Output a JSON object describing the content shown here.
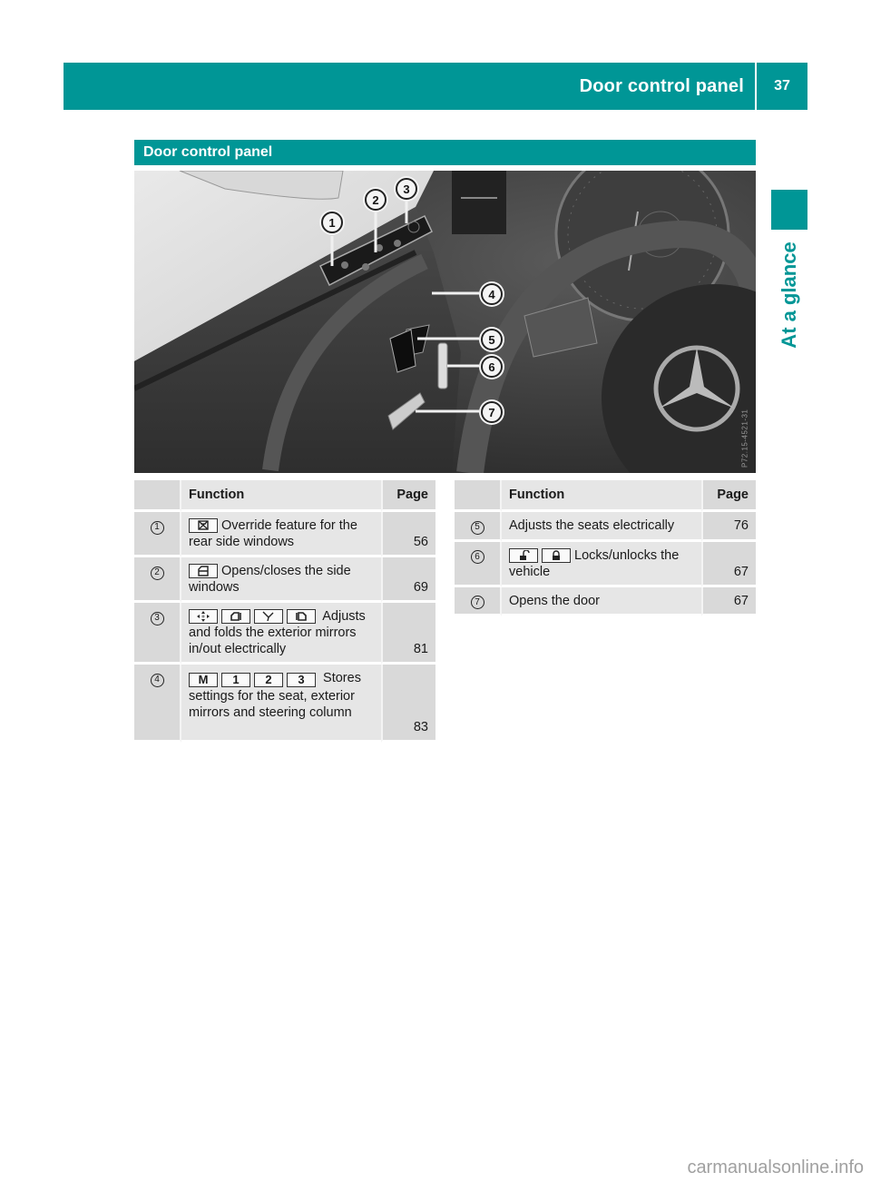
{
  "running_header": {
    "title": "Door control panel",
    "page_number": "37"
  },
  "side_tab": {
    "label": "At a glance"
  },
  "section": {
    "title": "Door control panel"
  },
  "figure": {
    "image_code": "P72.15-4521-31",
    "callouts": [
      "1",
      "2",
      "3",
      "4",
      "5",
      "6",
      "7"
    ]
  },
  "table_left": {
    "headers": {
      "number": "",
      "function": "Function",
      "page": "Page"
    },
    "rows": [
      {
        "number": "1",
        "icons": [
          "rear-window-override-icon"
        ],
        "text": "Override feature for the rear side windows",
        "page": "56"
      },
      {
        "number": "2",
        "icons": [
          "side-window-icon"
        ],
        "text": "Opens/closes the side windows",
        "page": "69"
      },
      {
        "number": "3",
        "icons": [
          "mirror-adjust-arrows-icon",
          "left-mirror-icon",
          "mirror-fold-icon",
          "right-mirror-icon"
        ],
        "text": "Adjusts and folds the exterior mirrors in/out electrically",
        "page": "81"
      },
      {
        "number": "4",
        "keys": [
          "M",
          "1",
          "2",
          "3"
        ],
        "text": "Stores settings for the seat, exterior mirrors and steering column",
        "page": "83"
      }
    ]
  },
  "table_right": {
    "headers": {
      "number": "",
      "function": "Function",
      "page": "Page"
    },
    "rows": [
      {
        "number": "5",
        "text": "Adjusts the seats electrically",
        "page": "76"
      },
      {
        "number": "6",
        "icons": [
          "unlock-icon",
          "lock-icon"
        ],
        "text": "Locks/unlocks the vehicle",
        "page": "67"
      },
      {
        "number": "7",
        "text": "Opens the door",
        "page": "67"
      }
    ]
  },
  "watermark": "carmanualsonline.info",
  "colors": {
    "accent": "#009696",
    "table_bg": "#e6e6e6",
    "table_col_bg": "#d9d9d9"
  }
}
